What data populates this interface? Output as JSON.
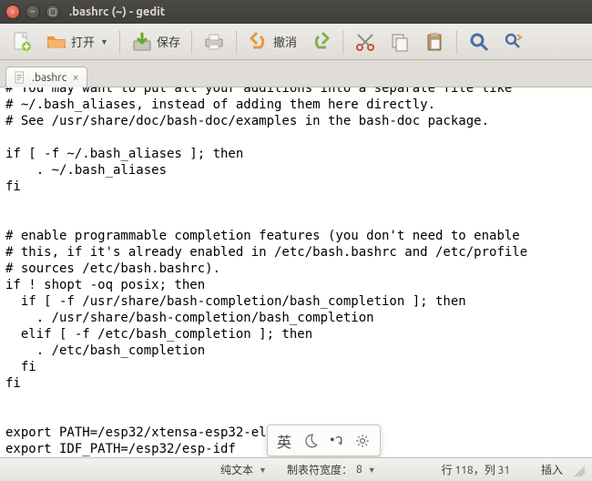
{
  "window": {
    "title": ".bashrc (~) - gedit"
  },
  "toolbar": {
    "open_label": "打开",
    "save_label": "保存",
    "undo_label": "撤消"
  },
  "tab": {
    "label": ".bashrc"
  },
  "editor": {
    "content": "# You may want to put all your additions into a separate file like\n# ~/.bash_aliases, instead of adding them here directly.\n# See /usr/share/doc/bash-doc/examples in the bash-doc package.\n\nif [ -f ~/.bash_aliases ]; then\n    . ~/.bash_aliases\nfi\n\n\n# enable programmable completion features (you don't need to enable\n# this, if it's already enabled in /etc/bash.bashrc and /etc/profile\n# sources /etc/bash.bashrc).\nif ! shopt -oq posix; then\n  if [ -f /usr/share/bash-completion/bash_completion ]; then\n    . /usr/share/bash-completion/bash_completion\n  elif [ -f /etc/bash_completion ]; then\n    . /etc/bash_completion\n  fi\nfi\n\n\nexport PATH=/esp32/xtensa-esp32-elf/bin:$PATH\nexport IDF_PATH=/esp32/esp-idf"
  },
  "ime": {
    "lang": "英"
  },
  "statusbar": {
    "syntax": "纯文本",
    "tabwidth_label": "制表符宽度：",
    "tabwidth_value": "8",
    "line_col": "行 118，列 31",
    "mode": "插入"
  }
}
